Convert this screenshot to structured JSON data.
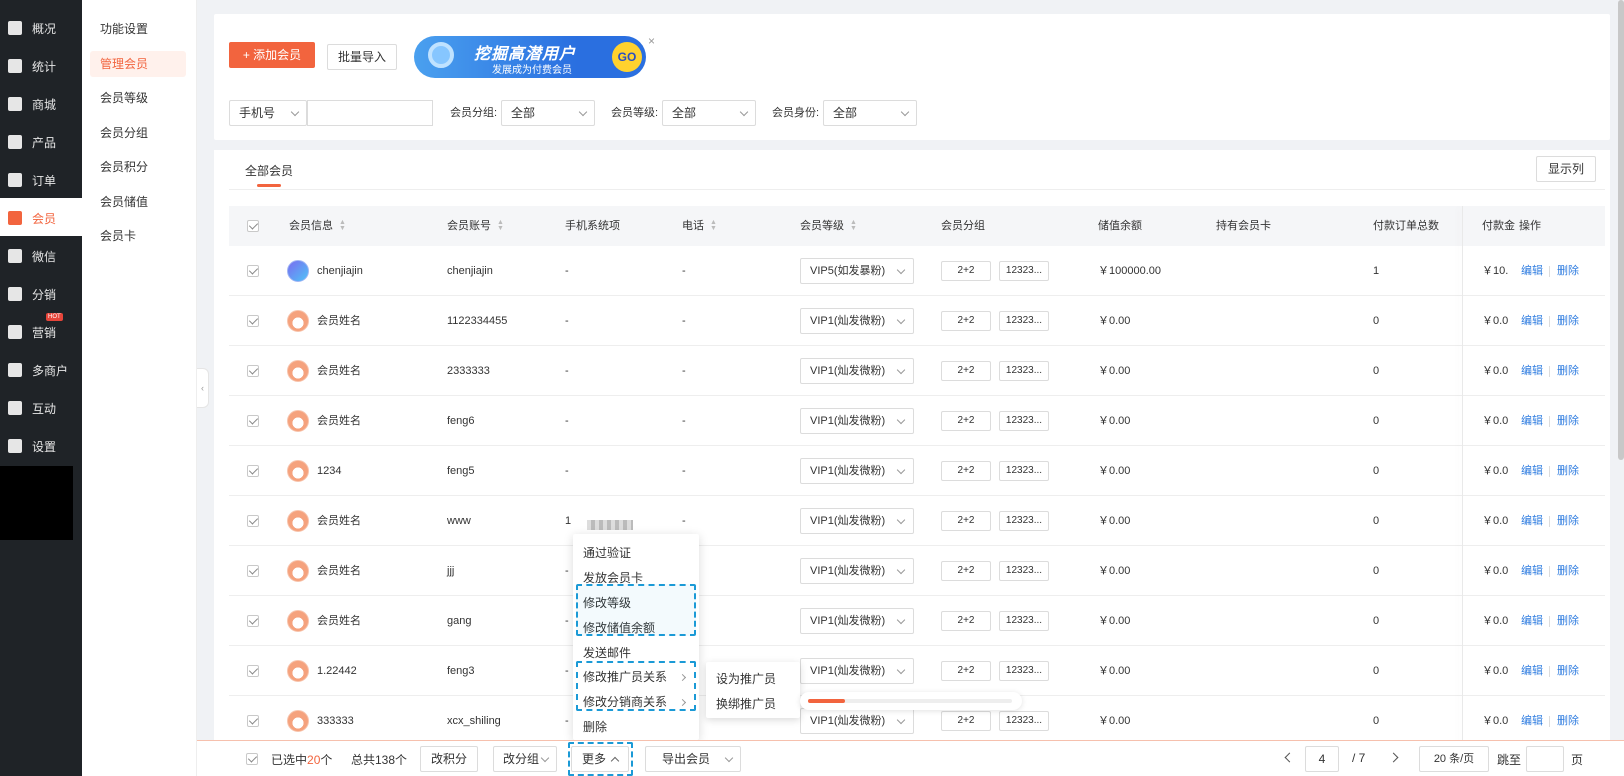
{
  "nav": {
    "items": [
      {
        "label": "概况",
        "icon": "layers-icon"
      },
      {
        "label": "统计",
        "icon": "chart-icon"
      },
      {
        "label": "商城",
        "icon": "store-icon"
      },
      {
        "label": "产品",
        "icon": "grid-icon"
      },
      {
        "label": "订单",
        "icon": "clipboard-icon"
      },
      {
        "label": "会员",
        "icon": "crown-icon",
        "active": true
      },
      {
        "label": "微信",
        "icon": "wechat-icon"
      },
      {
        "label": "分销",
        "icon": "users-icon"
      },
      {
        "label": "营销",
        "icon": "flag-icon",
        "badge": "HOT"
      },
      {
        "label": "多商户",
        "icon": "multi-store-icon"
      },
      {
        "label": "互动",
        "icon": "interact-icon"
      },
      {
        "label": "设置",
        "icon": "gear-icon"
      }
    ]
  },
  "subnav": {
    "items": [
      "功能设置",
      "管理会员",
      "会员等级",
      "会员分组",
      "会员积分",
      "会员储值",
      "会员卡"
    ],
    "active_index": 1
  },
  "toolbar": {
    "add_label": "+ 添加会员",
    "import_label": "批量导入",
    "banner_title": "挖掘高潜用户",
    "banner_sub": "发展成为付费会员",
    "banner_go": "GO",
    "banner_close": "×"
  },
  "filters": {
    "phone_select": "手机号",
    "group_label": "会员分组:",
    "group_value": "全部",
    "level_label": "会员等级:",
    "level_value": "全部",
    "identity_label": "会员身份:",
    "identity_value": "全部"
  },
  "tabs": {
    "all_members": "全部会员",
    "show_columns": "显示列"
  },
  "table": {
    "headers": [
      "会员信息",
      "会员账号",
      "手机系统项",
      "电话",
      "会员等级",
      "会员分组",
      "储值余额",
      "持有会员卡",
      "付款订单总数",
      "付款金",
      "操作"
    ],
    "rows": [
      {
        "name": "chenjiajin",
        "account": "chenjiajin",
        "phone_sys": "-",
        "tel": "-",
        "level": "VIP5(如发暴粉)",
        "group1": "2+2",
        "group2": "12323...",
        "balance": "￥100000.00",
        "orders": "1",
        "amount": "￥10.",
        "avatar": "alt"
      },
      {
        "name": "会员姓名",
        "account": "1122334455",
        "phone_sys": "-",
        "tel": "-",
        "level": "VIP1(灿发微粉)",
        "group1": "2+2",
        "group2": "12323...",
        "balance": "￥0.00",
        "orders": "0",
        "amount": "￥0.0"
      },
      {
        "name": "会员姓名",
        "account": "2333333",
        "phone_sys": "-",
        "tel": "-",
        "level": "VIP1(灿发微粉)",
        "group1": "2+2",
        "group2": "12323...",
        "balance": "￥0.00",
        "orders": "0",
        "amount": "￥0.0"
      },
      {
        "name": "会员姓名",
        "account": "feng6",
        "phone_sys": "-",
        "tel": "-",
        "level": "VIP1(灿发微粉)",
        "group1": "2+2",
        "group2": "12323...",
        "balance": "￥0.00",
        "orders": "0",
        "amount": "￥0.0"
      },
      {
        "name": "1234",
        "account": "feng5",
        "phone_sys": "-",
        "tel": "-",
        "level": "VIP1(灿发微粉)",
        "group1": "2+2",
        "group2": "12323...",
        "balance": "￥0.00",
        "orders": "0",
        "amount": "￥0.0"
      },
      {
        "name": "会员姓名",
        "account": "www",
        "phone_sys": "1",
        "tel": "-",
        "level": "VIP1(灿发微粉)",
        "group1": "2+2",
        "group2": "12323...",
        "balance": "￥0.00",
        "orders": "0",
        "amount": "￥0.0"
      },
      {
        "name": "会员姓名",
        "account": "jjj",
        "phone_sys": "-",
        "tel": "",
        "level": "VIP1(灿发微粉)",
        "group1": "2+2",
        "group2": "12323...",
        "balance": "￥0.00",
        "orders": "0",
        "amount": "￥0.0"
      },
      {
        "name": "会员姓名",
        "account": "gang",
        "phone_sys": "-",
        "tel": "",
        "level": "VIP1(灿发微粉)",
        "group1": "2+2",
        "group2": "12323...",
        "balance": "￥0.00",
        "orders": "0",
        "amount": "￥0.0"
      },
      {
        "name": "1.22442",
        "account": "feng3",
        "phone_sys": "-",
        "tel": "",
        "level": "VIP1(灿发微粉)",
        "group1": "2+2",
        "group2": "12323...",
        "balance": "￥0.00",
        "orders": "0",
        "amount": "￥0.0"
      },
      {
        "name": "333333",
        "account": "xcx_shiling",
        "phone_sys": "-",
        "tel": "",
        "level": "VIP1(灿发微粉)",
        "group1": "2+2",
        "group2": "12323...",
        "balance": "￥0.00",
        "orders": "0",
        "amount": "￥0.0"
      }
    ],
    "edit_label": "编辑",
    "delete_label": "删除"
  },
  "more_menu": {
    "items": [
      "通过验证",
      "发放会员卡",
      "修改等级",
      "修改储值余额",
      "发送邮件",
      "修改推广员关系",
      "修改分销商关系",
      "删除"
    ],
    "submenu": [
      "设为推广员",
      "换绑推广员"
    ],
    "progress": 0.18
  },
  "bottombar": {
    "selected_prefix": "已选中",
    "selected_count": "20",
    "selected_suffix": "个",
    "total": "总共138个",
    "points_btn": "改积分",
    "group_btn": "改分组",
    "more_btn": "更多",
    "export_btn": "导出会员",
    "page_current": "4",
    "page_total": "/ 7",
    "page_size": "20 条/页",
    "jump_label": "跳至",
    "page_unit": "页"
  },
  "colors": {
    "accent": "#f2643e",
    "link": "#2e7ce0",
    "nav_bg": "#1f2327",
    "highlight_dash": "#1b9ad6"
  }
}
